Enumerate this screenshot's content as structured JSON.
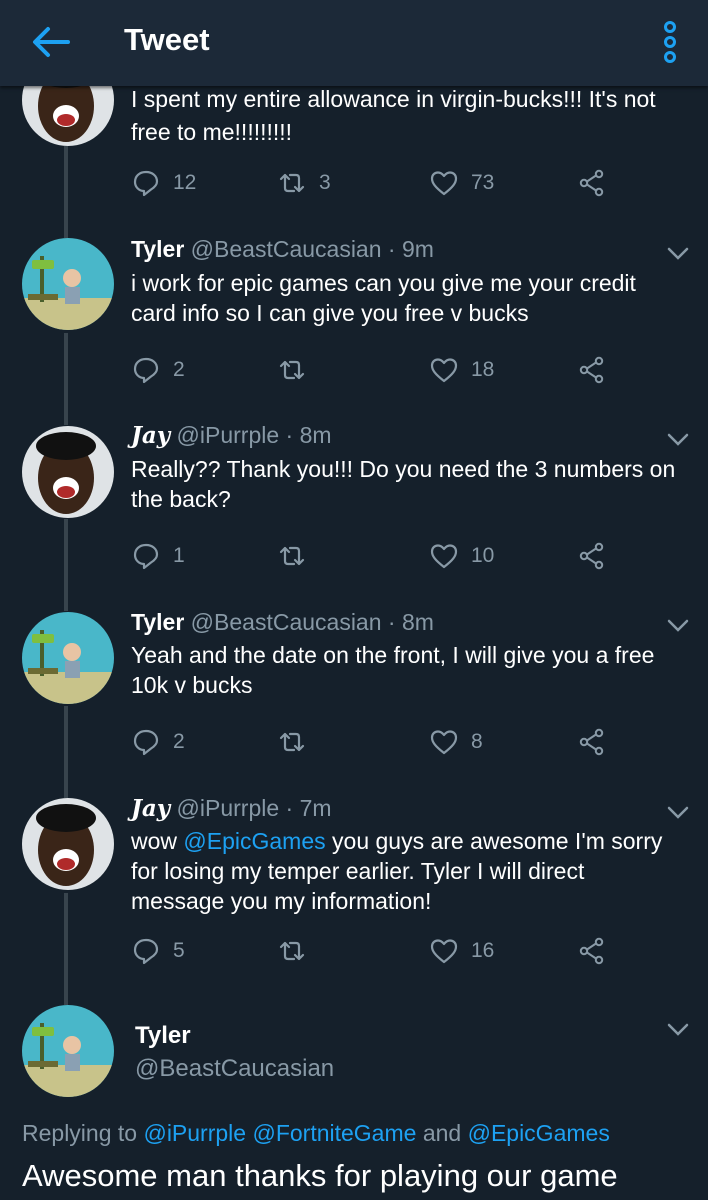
{
  "header": {
    "title": "Tweet",
    "back_icon": "arrow-left-icon",
    "menu_icon": "overflow-vertical-icon"
  },
  "colors": {
    "background": "#15202b",
    "header": "#1c2938",
    "accent": "#1da1f2",
    "muted": "#8899a6"
  },
  "top_tweet": {
    "text": "I spent my entire allowance in virgin-bucks!!! It's not free to me!!!!!!!!!",
    "replies": "12",
    "retweets": "3",
    "likes": "73"
  },
  "tweets": [
    {
      "name": "Tyler",
      "handle": "@BeastCaucasian",
      "time": "9m",
      "text": "i work for epic games can you give me your credit card info so I can give you free v bucks",
      "replies": "2",
      "retweets": "",
      "likes": "18"
    },
    {
      "name": "Jay",
      "handle": "@iPurrple",
      "time": "8m",
      "text": "Really?? Thank you!!! Do you need the 3 numbers on the back?",
      "replies": "1",
      "retweets": "",
      "likes": "10"
    },
    {
      "name": "Tyler",
      "handle": "@BeastCaucasian",
      "time": "8m",
      "text": "Yeah and the date on the front, I will give you a free 10k v bucks",
      "replies": "2",
      "retweets": "",
      "likes": "8"
    },
    {
      "name": "Jay",
      "handle": "@iPurrple",
      "time": "7m",
      "text_mention": "@EpicGames",
      "text_prefix": "wow ",
      "text_suffix": " you guys are awesome I'm sorry for losing my temper earlier. Tyler I will direct message you my information!",
      "replies": "5",
      "retweets": "",
      "likes": "16"
    }
  ],
  "focused_tweet": {
    "name": "Tyler",
    "handle": "@BeastCaucasian",
    "reply_prefix": "Replying to ",
    "reply_mention_1": "@iPurrple",
    "reply_mention_2": "@FortniteGame",
    "reply_and": " and ",
    "reply_mention_3": "@EpicGames",
    "text": "Awesome man thanks for playing our game"
  },
  "sep": "·"
}
